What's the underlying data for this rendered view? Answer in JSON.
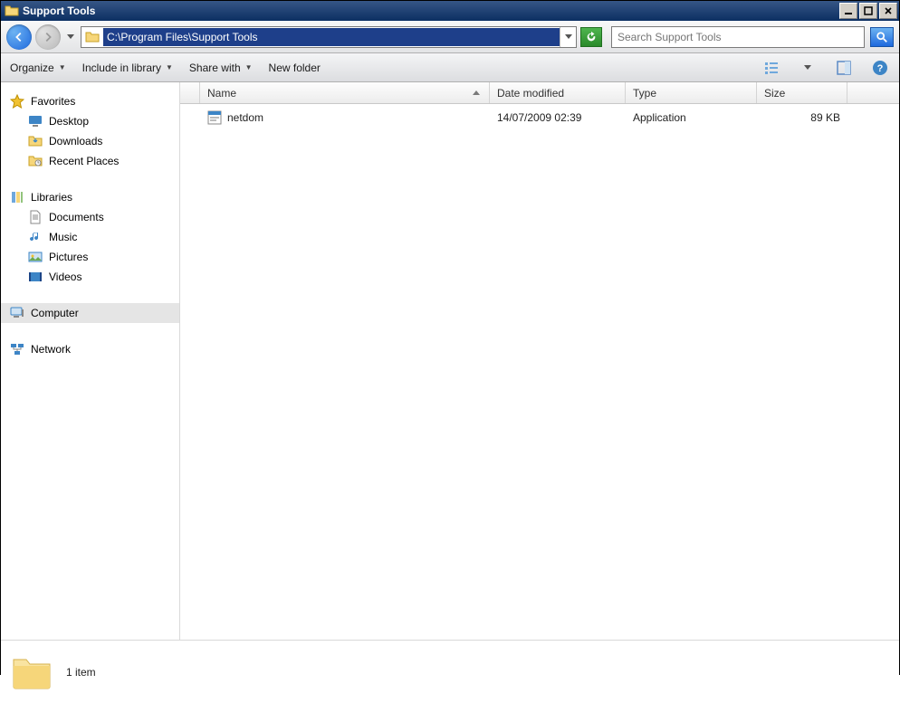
{
  "window": {
    "title": "Support Tools"
  },
  "nav": {
    "address": "C:\\Program Files\\Support Tools",
    "search_placeholder": "Search Support Tools"
  },
  "toolbar": {
    "organize": "Organize",
    "include": "Include in library",
    "share": "Share with",
    "newfolder": "New folder"
  },
  "sidebar": {
    "favorites": {
      "label": "Favorites",
      "items": [
        "Desktop",
        "Downloads",
        "Recent Places"
      ]
    },
    "libraries": {
      "label": "Libraries",
      "items": [
        "Documents",
        "Music",
        "Pictures",
        "Videos"
      ]
    },
    "computer": {
      "label": "Computer"
    },
    "network": {
      "label": "Network"
    }
  },
  "columns": {
    "name": "Name",
    "modified": "Date modified",
    "type": "Type",
    "size": "Size"
  },
  "files": [
    {
      "name": "netdom",
      "modified": "14/07/2009 02:39",
      "type": "Application",
      "size": "89 KB"
    }
  ],
  "status": {
    "count_label": "1 item"
  }
}
